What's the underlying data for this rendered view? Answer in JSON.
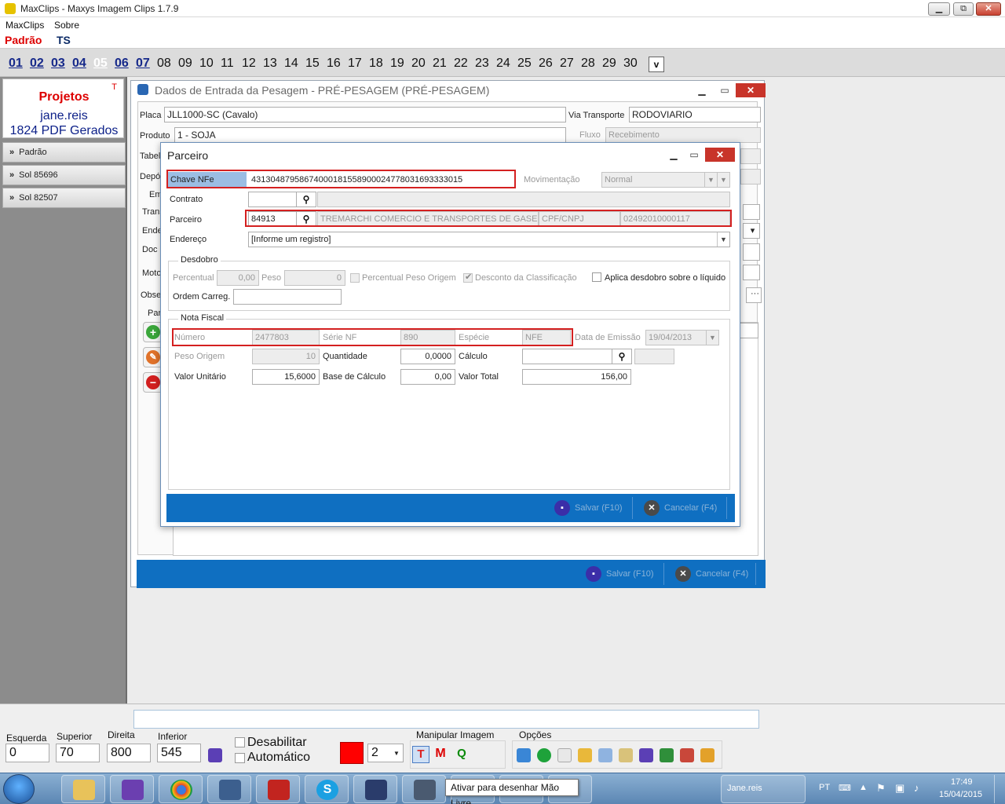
{
  "window": {
    "title": "MaxClips - Maxys Imagem Clips 1.7.9",
    "minimize": "▁",
    "restore": "⧉",
    "close": "✕"
  },
  "menu": {
    "items": [
      "MaxClips",
      "Sobre"
    ]
  },
  "userbar": {
    "profile": "Padrão",
    "code": "TS"
  },
  "days": {
    "items": [
      "01",
      "02",
      "03",
      "04",
      "05",
      "06",
      "07",
      "08",
      "09",
      "10",
      "11",
      "12",
      "13",
      "14",
      "15",
      "16",
      "17",
      "18",
      "19",
      "20",
      "21",
      "22",
      "23",
      "24",
      "25",
      "26",
      "27",
      "28",
      "29",
      "30"
    ],
    "toggle": "v"
  },
  "left_panel": {
    "projects_title": "Projetos",
    "user": "jane.reis",
    "pdf_count": "1824 PDF Gerados",
    "mark": "T",
    "nav": [
      "Padrão",
      "Sol 85696",
      "Sol 82507"
    ]
  },
  "main_window": {
    "title": "Dados de Entrada da Pesagem - PRÉ-PESAGEM (PRÉ-PESAGEM)",
    "labels": {
      "placa": "Placa",
      "produto": "Produto",
      "tabela": "Tabel",
      "deposito": "Depó",
      "em": "Em",
      "trans": "Trans",
      "ende": "Ende",
      "doc": "Doc F",
      "moto": "Moto",
      "obse": "Obse",
      "par": "Par",
      "via": "Via Transporte",
      "fluxo": "Fluxo"
    },
    "values": {
      "placa": "JLL1000-SC (Cavalo)",
      "produto": "1 - SOJA",
      "via": "RODOVIARIO",
      "fluxo": "Recebimento"
    },
    "salvar": "Salvar (F10)",
    "cancelar": "Cancelar (F4)"
  },
  "dialog": {
    "title": "Parceiro",
    "labels": {
      "chave": "Chave NFe",
      "movimentacao": "Movimentação",
      "contrato": "Contrato",
      "parceiro": "Parceiro",
      "endereco": "Endereço",
      "cpf": "CPF/CNPJ"
    },
    "values": {
      "chave": "43130487958674000181558900024778031693333015",
      "movimentacao": "Normal",
      "parceiro_codigo": "84913",
      "parceiro_nome": "TREMARCHI COMERCIO E TRANSPORTES DE GASES I...",
      "cpf": "02492010000117",
      "endereco": "[Informe um registro]"
    },
    "desdobro": {
      "title": "Desdobro",
      "percentual_label": "Percentual",
      "percentual": "0,00",
      "peso_label": "Peso",
      "peso": "0",
      "percentual_peso_origem": "Percentual Peso Origem",
      "desconto_classificacao": "Desconto da Classificação",
      "aplica_desdobro": "Aplica desdobro sobre o líquido",
      "ordem_label": "Ordem Carreg."
    },
    "nota": {
      "title": "Nota Fiscal",
      "numero_label": "Número",
      "numero": "2477803",
      "serie_label": "Série NF",
      "serie": "890",
      "especie_label": "Espécie",
      "especie": "NFE",
      "data_label": "Data de Emissão",
      "data": "19/04/2013",
      "peso_origem_label": "Peso Origem",
      "peso_origem": "10",
      "quantidade_label": "Quantidade",
      "quantidade": "0,0000",
      "calculo_label": "Cálculo",
      "valor_unitario_label": "Valor Unitário",
      "valor_unitario": "15,6000",
      "base_label": "Base de Cálculo",
      "base": "0,00",
      "valor_total_label": "Valor Total",
      "valor_total": "156,00"
    },
    "salvar": "Salvar (F10)",
    "cancelar": "Cancelar (F4)"
  },
  "bottom": {
    "esquerda_label": "Esquerda",
    "esquerda": "0",
    "superior_label": "Superior",
    "superior": "70",
    "direita_label": "Direita",
    "direita": "800",
    "inferior_label": "Inferior",
    "inferior": "545",
    "desabilitar": "Desabilitar",
    "automatico": "Automático",
    "stroke": "2",
    "manipular": "Manipular Imagem",
    "opcoes": "Opções",
    "tool_t": "T",
    "tool_m": "M",
    "tool_q": "Q"
  },
  "taskbar": {
    "tooltip": "Ativar para desenhar Mão Livre",
    "user": "Jane.reis",
    "lang": "PT",
    "time": "17:49",
    "date": "15/04/2015"
  },
  "colors": {
    "accent_blue": "#0f6fc1",
    "highlight_red": "#d42020",
    "brand_red": "#dd0000"
  }
}
